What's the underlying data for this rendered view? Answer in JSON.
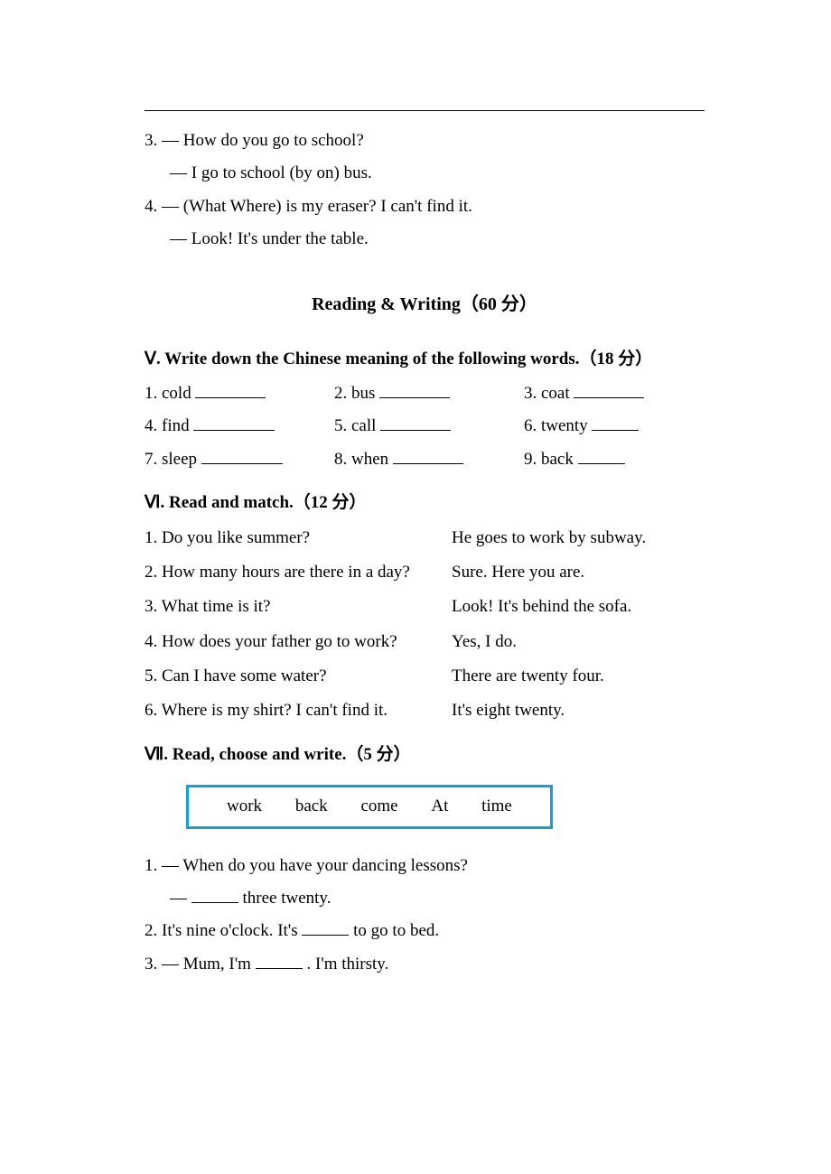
{
  "prior": {
    "q3a": "3. — How do you go to school?",
    "q3b": "— I go to school (by   on) bus.",
    "q4a": "4. — (What   Where) is my eraser? I can't find it.",
    "q4b": "— Look! It's under the table."
  },
  "section_title": "Reading & Writing（60 分）",
  "sec5": {
    "heading": "Ⅴ. Write down the Chinese meaning of the following words.（18 分）",
    "items": [
      "1. cold",
      "2. bus",
      "3. coat",
      "4. find",
      "5. call",
      "6. twenty",
      "7. sleep",
      "8. when",
      "9. back"
    ]
  },
  "sec6": {
    "heading": "Ⅵ. Read and match.（12 分）",
    "rows": [
      {
        "l": "1. Do you like summer?",
        "r": "He goes to work by subway."
      },
      {
        "l": "2. How many hours are there in a day?",
        "r": "Sure. Here you are."
      },
      {
        "l": "3. What time is it?",
        "r": "Look! It's behind the sofa."
      },
      {
        "l": "4. How does your father go to work?",
        "r": "Yes, I do."
      },
      {
        "l": "5. Can I have some water?",
        "r": "There are twenty four."
      },
      {
        "l": "6. Where is my shirt? I can't find it.",
        "r": "It's eight twenty."
      }
    ]
  },
  "sec7": {
    "heading": "Ⅶ. Read, choose and write.（5 分）",
    "box": [
      "work",
      "back",
      "come",
      "At",
      "time"
    ],
    "q1a": "1. — When do you have your dancing lessons?",
    "q1b_prefix": "— ",
    "q1b_suffix": " three twenty.",
    "q2_prefix": "2. It's nine o'clock. It's ",
    "q2_suffix": " to go to bed.",
    "q3_prefix": "3. — Mum, I'm ",
    "q3_suffix": ". I'm thirsty."
  }
}
